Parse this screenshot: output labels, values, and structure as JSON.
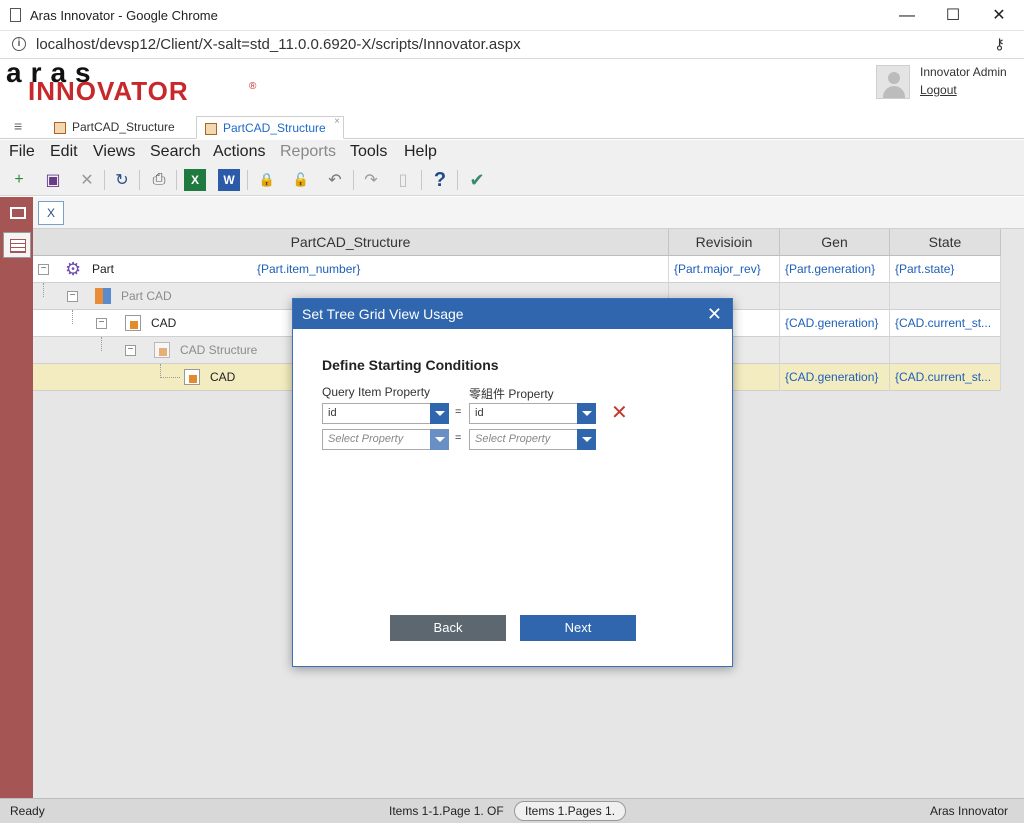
{
  "window": {
    "title": "Aras Innovator - Google Chrome",
    "min": "—",
    "max": "☐",
    "close": "✕"
  },
  "address": {
    "url": "localhost/devsp12/Client/X-salt=std_11.0.0.6920-X/scripts/Innovator.aspx",
    "info": "i",
    "key": "⚷"
  },
  "brand": {
    "top": "aras",
    "bottom": "INNOVATOR",
    "reg": "®"
  },
  "user": {
    "name": "Innovator Admin",
    "logout": "Logout"
  },
  "tabs": [
    {
      "label": "PartCAD_Structure"
    },
    {
      "label": "PartCAD_Structure",
      "close": "×"
    }
  ],
  "menu": [
    "File",
    "Edit",
    "Views",
    "Search",
    "Actions",
    "Reports",
    "Tools",
    "Help"
  ],
  "toolbar": {
    "new": "+",
    "save": "▣",
    "discard": "✕",
    "refresh": "↻",
    "print": "⎙",
    "excel": "X",
    "word": "W",
    "lock": "🔒",
    "unlock": "🔓",
    "undo": "↶",
    "redo": "↷",
    "clip": "▯",
    "help": "?",
    "done": "✔"
  },
  "content_toolbar": {
    "excel_label": "X"
  },
  "grid": {
    "headers": [
      "PartCAD_Structure",
      "Revisioin",
      "Gen",
      "State"
    ],
    "rows": [
      {
        "name": "Part",
        "number": "{Part.item_number}",
        "rev": "{Part.major_rev}",
        "gen": "{Part.generation}",
        "state": "{Part.state}",
        "toggle": "−"
      },
      {
        "name": "Part CAD",
        "number": "",
        "rev": "",
        "gen": "",
        "state": "",
        "toggle": "−"
      },
      {
        "name": "CAD",
        "number": "",
        "rev": "jor_rev}",
        "gen": "{CAD.generation}",
        "state": "{CAD.current_st...",
        "toggle": "−"
      },
      {
        "name": "CAD Structure",
        "number": "",
        "rev": "",
        "gen": "",
        "state": "",
        "toggle": "−"
      },
      {
        "name": "CAD",
        "number": "",
        "rev": "jor_rev}",
        "gen": "{CAD.generation}",
        "state": "{CAD.current_st..."
      }
    ]
  },
  "dialog": {
    "title": "Set Tree Grid View Usage",
    "close": "✕",
    "heading": "Define Starting Conditions",
    "left_label": "Query Item Property",
    "right_label": "零組件 Property",
    "row1": {
      "left": "id",
      "right": "id",
      "eq": "=",
      "remove": "✕"
    },
    "row2": {
      "left_placeholder": "Select Property",
      "right_placeholder": "Select Property",
      "eq": "="
    },
    "back": "Back",
    "next": "Next"
  },
  "status": {
    "ready": "Ready",
    "items": "Items 1-1.Page 1. OF",
    "pages": "Items 1.Pages 1.",
    "app": "Aras Innovator"
  }
}
